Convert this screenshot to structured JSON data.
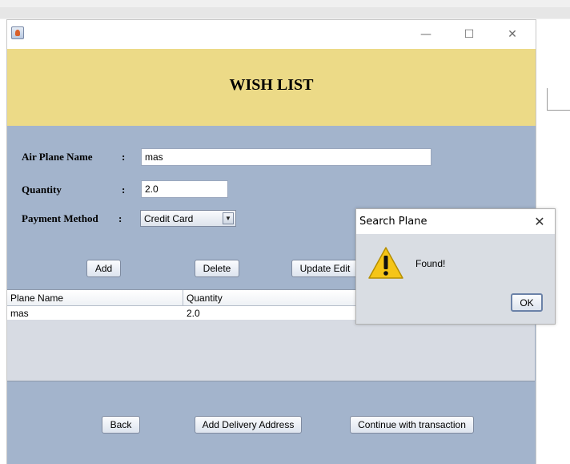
{
  "window": {
    "title_controls": {
      "minimize": "—",
      "maximize": "☐",
      "close": "✕"
    }
  },
  "banner": {
    "title": "WISH LIST"
  },
  "form": {
    "plane_name_label": "Air Plane Name",
    "plane_name_colon": ":",
    "plane_name_value": "mas",
    "quantity_label": "Quantity",
    "quantity_colon": ":",
    "quantity_value": "2.0",
    "payment_label": "Payment Method",
    "payment_colon": ":",
    "payment_selected": "Credit Card",
    "payment_arrow": "▼"
  },
  "actions": {
    "add": "Add",
    "delete": "Delete",
    "update_edit": "Update Edit"
  },
  "table": {
    "columns": [
      "Plane Name",
      "Quantity"
    ],
    "rows": [
      [
        "mas",
        "2.0"
      ]
    ]
  },
  "footer": {
    "back": "Back",
    "add_delivery": "Add Delivery Address",
    "continue": "Continue with transaction"
  },
  "dialog": {
    "title": "Search Plane",
    "close": "✕",
    "message": "Found!",
    "ok": "OK",
    "icon": "warning-icon",
    "icon_color": "#f5c518"
  }
}
